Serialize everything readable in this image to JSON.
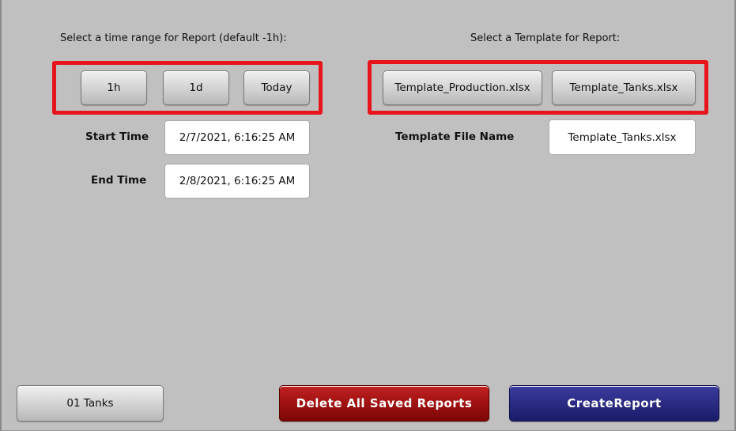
{
  "time_range": {
    "heading": "Select a time range for Report (default -1h):",
    "buttons": [
      "1h",
      "1d",
      "Today"
    ],
    "start_label": "Start Time",
    "start_value": "2/7/2021, 6:16:25 AM",
    "end_label": "End Time",
    "end_value": "2/8/2021, 6:16:25 AM"
  },
  "template": {
    "heading": "Select a Template for Report:",
    "buttons": [
      "Template_Production.xlsx",
      "Template_Tanks.xlsx"
    ],
    "file_label": "Template File Name",
    "file_value": "Template_Tanks.xlsx"
  },
  "footer": {
    "tanks_button": "01 Tanks",
    "delete_button": "Delete All Saved Reports",
    "create_button": "CreateReport"
  },
  "colors": {
    "highlight": "#e8141c",
    "delete_bg": "#a01010",
    "create_bg": "#2a2a85"
  }
}
